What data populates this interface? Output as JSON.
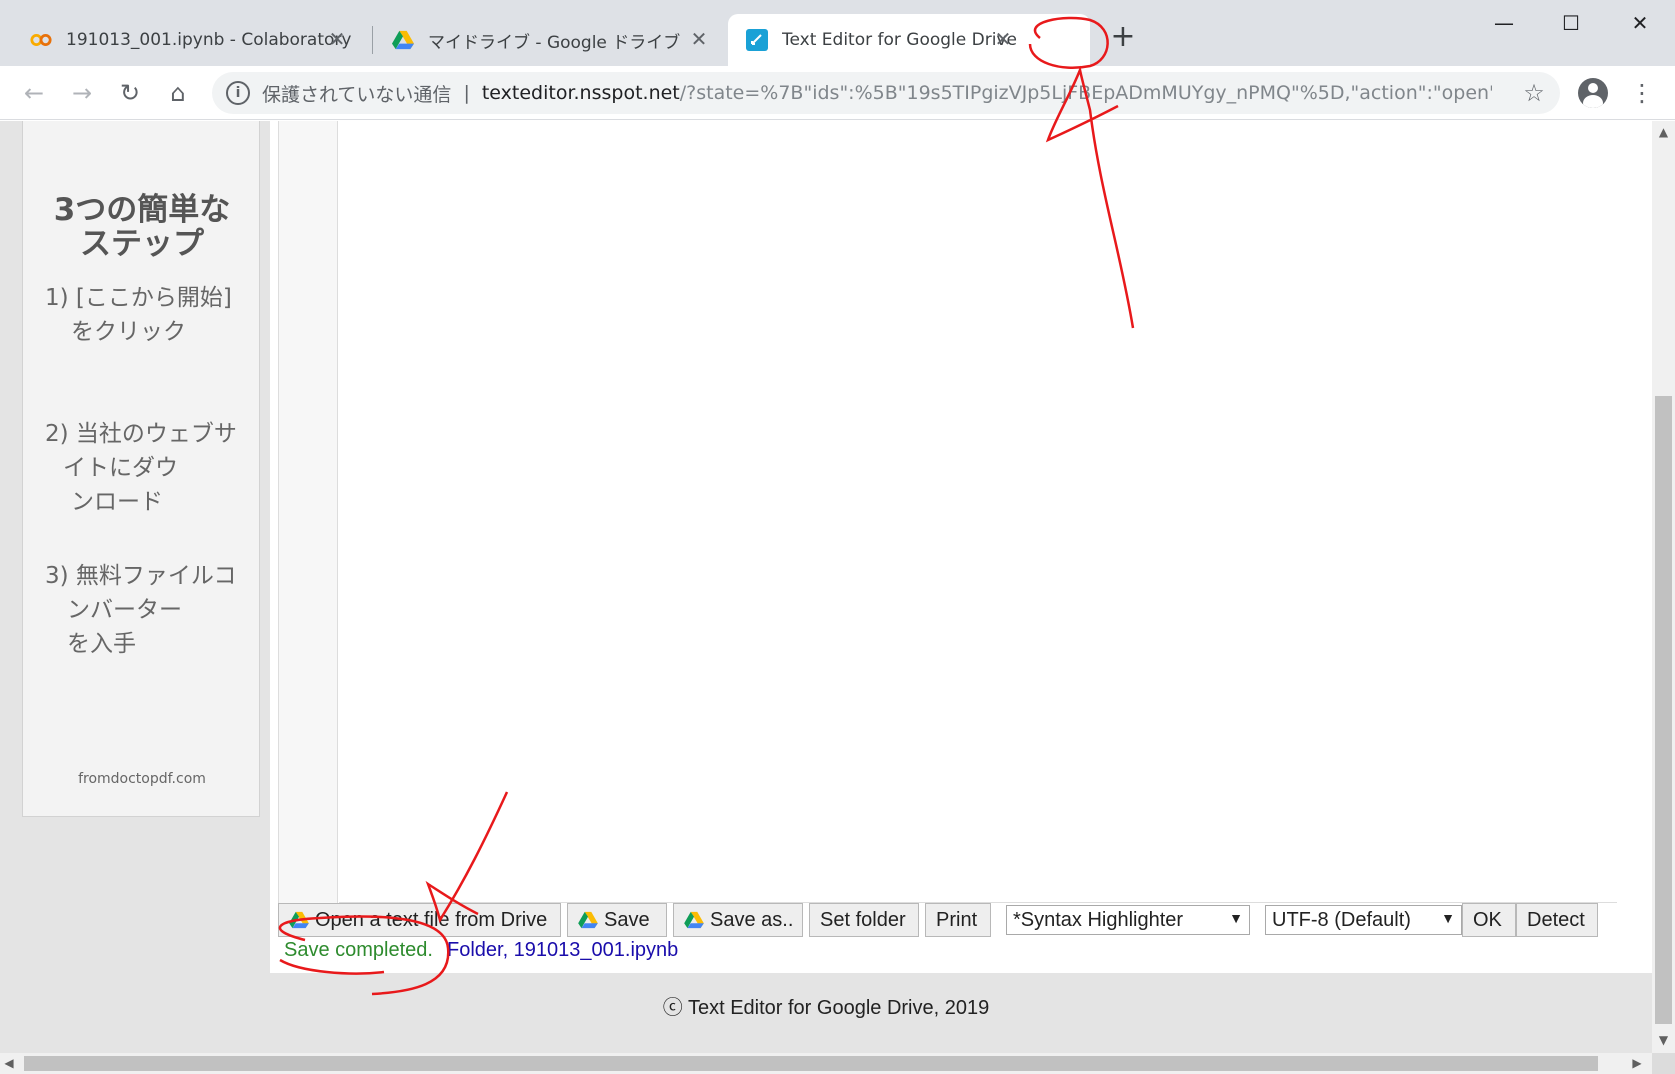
{
  "browser": {
    "tabs": [
      {
        "title": "191013_001.ipynb - Colaboratory",
        "icon": "colab-icon"
      },
      {
        "title": "マイドライブ - Google ドライブ",
        "icon": "google-drive-icon"
      },
      {
        "title": "Text Editor for Google Drive",
        "icon": "text-editor-icon",
        "active": true
      }
    ],
    "address": {
      "security_label": "保護されていない通信",
      "host": "texteditor.nsspot.net",
      "path": "/?state=%7B\"ids\":%5B\"19s5TIPgizVJp5LjFBEpADmMUYgy_nPMQ\"%5D,\"action\":\"open\",\"u..."
    }
  },
  "ad": {
    "title_line1": "3つの簡単な",
    "title_line2": "ステップ",
    "step1_line1": "1) [ここから開始]",
    "step1_line2": "をクリック",
    "step2_line1": "2) 当社のウェブサ",
    "step2_line2": "イトにダウ",
    "step2_line3": "ンロード",
    "step3_line1": "3) 無料ファイルコ",
    "step3_line2": "ンバーター",
    "step3_line3": "を入手",
    "footer": "fromdoctopdf.com"
  },
  "editor": {
    "buttons": {
      "open": "Open a text file from Drive",
      "save": "Save",
      "save_as": "Save as..",
      "set_folder": "Set folder",
      "print": "Print",
      "ok": "OK",
      "detect": "Detect"
    },
    "syntax_select": "*Syntax Highlighter",
    "encoding_select": "UTF-8 (Default)",
    "status": "Save completed.",
    "file_link": "Folder, 191013_001.ipynb"
  },
  "footer": "ⓒ Text Editor for Google Drive, 2019",
  "colors": {
    "status_green": "#2e8b2e",
    "link_blue": "#1a0dab",
    "annotation_red": "#e8191b"
  }
}
